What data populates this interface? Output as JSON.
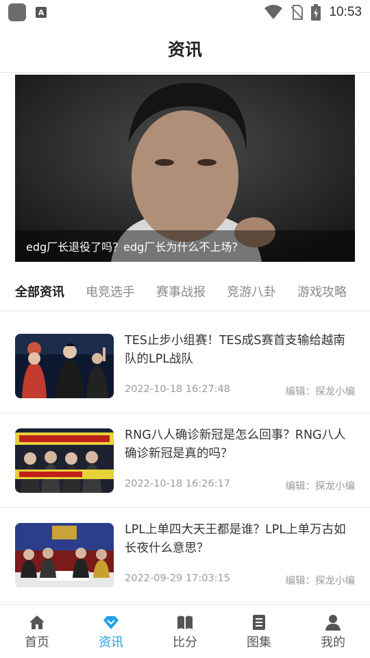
{
  "status_bar": {
    "time": "10:53",
    "badge_letter": "A"
  },
  "header": {
    "title": "资讯"
  },
  "banner": {
    "caption": "edg厂长退役了吗？edg厂长为什么不上场？"
  },
  "tabs": [
    {
      "label": "全部资讯",
      "active": true
    },
    {
      "label": "电竞选手",
      "active": false
    },
    {
      "label": "赛事战报",
      "active": false
    },
    {
      "label": "竞游八卦",
      "active": false
    },
    {
      "label": "游戏攻略",
      "active": false
    }
  ],
  "news": [
    {
      "title": "TES止步小组赛！TES成S赛首支输给越南队的LPL战队",
      "date": "2022-10-18 16:27:48",
      "editor": "编辑：探龙小编"
    },
    {
      "title": "RNG八人确诊新冠是怎么回事？RNG八人确诊新冠是真的吗？",
      "date": "2022-10-18 16:26:17",
      "editor": "编辑：探龙小编"
    },
    {
      "title": "LPL上单四大天王都是谁？LPL上单万古如长夜什么意思？",
      "date": "2022-09-29 17:03:15",
      "editor": "编辑：探龙小编"
    }
  ],
  "bottom_nav": [
    {
      "label": "首页",
      "icon": "home-icon",
      "active": false
    },
    {
      "label": "资讯",
      "icon": "diamond-icon",
      "active": true
    },
    {
      "label": "比分",
      "icon": "book-icon",
      "active": false
    },
    {
      "label": "图集",
      "icon": "document-icon",
      "active": false
    },
    {
      "label": "我的",
      "icon": "person-icon",
      "active": false
    }
  ],
  "colors": {
    "accent": "#1ea0e6",
    "inactive_icon": "#555555",
    "divider": "#e3e3e3"
  }
}
